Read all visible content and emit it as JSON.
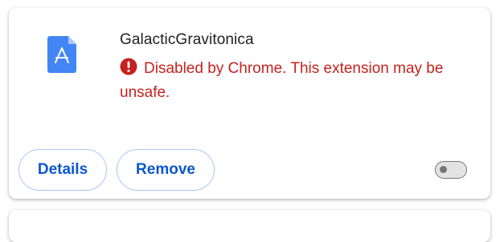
{
  "extension": {
    "name": "GalacticGravitonica",
    "icon": "app-store-file-icon",
    "warning": {
      "icon": "error-circle-icon",
      "text": "Disabled by Chrome. This extension may be unsafe."
    },
    "buttons": {
      "details_label": "Details",
      "remove_label": "Remove"
    },
    "enabled": false
  },
  "colors": {
    "warning": "#c5221f",
    "accent": "#0b57d0",
    "icon_blue": "#4285f4"
  }
}
